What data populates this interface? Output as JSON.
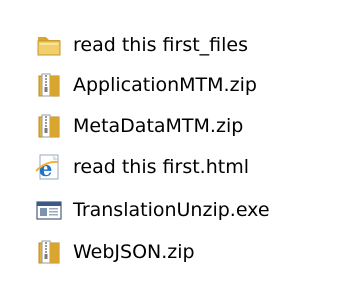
{
  "files": [
    {
      "name": "read this first_files",
      "icon": "folder-icon"
    },
    {
      "name": "ApplicationMTM.zip",
      "icon": "zip-archive-icon"
    },
    {
      "name": "MetaDataMTM.zip",
      "icon": "zip-archive-icon"
    },
    {
      "name": "read this first.html",
      "icon": "internet-explorer-html-icon"
    },
    {
      "name": "TranslationUnzip.exe",
      "icon": "executable-window-icon"
    },
    {
      "name": "WebJSON.zip",
      "icon": "zip-archive-icon"
    }
  ],
  "colors": {
    "folder_yellow": "#E8C25A",
    "zip_yellow": "#E2B33F",
    "ie_blue": "#1E73C8",
    "exe_frame": "#3B5B86"
  }
}
